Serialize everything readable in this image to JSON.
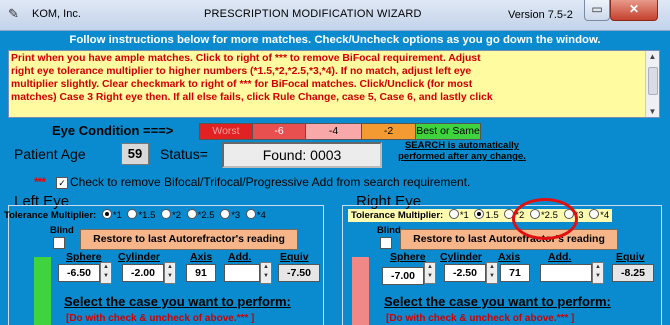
{
  "window": {
    "app_name": "KOM, Inc.",
    "title": "PRESCRIPTION MODIFICATION WIZARD",
    "version": "Version 7.5-2",
    "minimize_icon": "minimize-icon",
    "close_icon": "close-icon"
  },
  "instructions": {
    "header": "Follow instructions below for more matches. Check/Uncheck options as you go down the window.",
    "lines": [
      "Print when you have ample matches. Click to right of *** to remove BiFocal requirement. Adjust",
      "right eye tolerance multiplier to higher numbers (*1.5,*2,*2.5,*3,*4). If no match, adjust left eye",
      "multiplier slightly. Clear checkmark to right of *** for BiFocal matches. Click/Unclick (for most",
      "matches) Case 3 Right eye then. If all else fails, click Rule Change, case 5, Case 6, and  lastly click"
    ]
  },
  "eye_condition": {
    "label": "Eye Condition ===>",
    "scale": [
      "Worst",
      "-6",
      "-4",
      "-2",
      "Best or Same"
    ],
    "colors": [
      "#e12222",
      "#e85050",
      "#f8a8a8",
      "#f39a33",
      "#3fd43f"
    ]
  },
  "patient": {
    "age_label": "Patient Age",
    "age": "59",
    "status_label": "Status=",
    "status_value": "Found:  0003",
    "search_note_1": "SEARCH is automatically",
    "search_note_2": "performed after any change."
  },
  "bifocal": {
    "stars": "***",
    "checked": true,
    "label": "Check to remove Bifocal/Trifocal/Progressive Add from search requirement."
  },
  "left_eye": {
    "title": "Left Eye",
    "tolerance_label": "Tolerance Multiplier:",
    "tolerance_options": [
      "*1",
      "*1.5",
      "*2",
      "*2.5",
      "*3",
      "*4"
    ],
    "tolerance_selected": "*1",
    "blind_label": "Blind",
    "restore_label": "Restore to last Autorefractor's reading",
    "headers": {
      "sphere": "Sphere",
      "cylinder": "Cylinder",
      "axis": "Axis",
      "add": "Add.",
      "equiv": "Equiv"
    },
    "values": {
      "sphere": "-6.50",
      "cylinder": "-2.00",
      "axis": "91",
      "add": "",
      "equiv": "-7.50"
    },
    "select_case": "Select the case you want to perform:",
    "do_note": "[Do with check & uncheck of above.***  ]"
  },
  "right_eye": {
    "title": "Right Eye",
    "tolerance_label": "Tolerance Multiplier:",
    "tolerance_options": [
      "*1",
      "1.5",
      "*2",
      "*2.5",
      "*3",
      "*4"
    ],
    "tolerance_selected": "1.5",
    "blind_label": "Blind",
    "restore_label": "Restore to last Autorefractor's reading",
    "headers": {
      "sphere": "Sphere",
      "cylinder": "Cylinder",
      "axis": "Axis",
      "add": "Add.",
      "equiv": "Equiv"
    },
    "values": {
      "sphere": "-7.00",
      "cylinder": "-2.50",
      "axis": "71",
      "add": "",
      "equiv": "-8.25"
    },
    "select_case": "Select the case you want to perform:",
    "do_note": "[Do with check & uncheck of above.***  ]"
  },
  "annotation_color": "#e01010"
}
